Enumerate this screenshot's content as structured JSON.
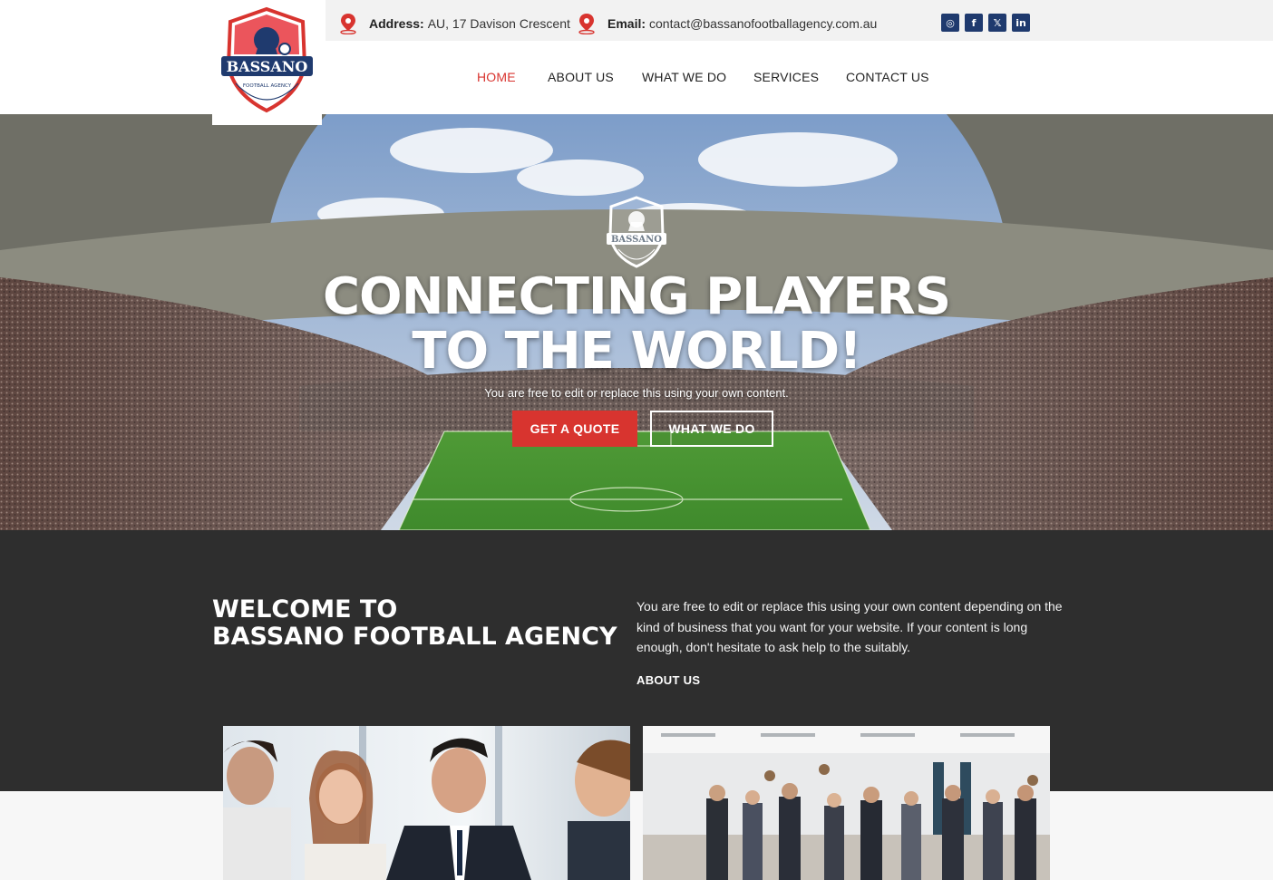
{
  "topbar": {
    "address_label": "Address:",
    "address_value": "AU, 17 Davison Crescent",
    "email_label": "Email:",
    "email_value": "contact@bassanofootballagency.com.au",
    "social": [
      {
        "name": "instagram-icon",
        "glyph": "◎"
      },
      {
        "name": "facebook-icon",
        "glyph": "f"
      },
      {
        "name": "x-icon",
        "glyph": "𝕏"
      },
      {
        "name": "linkedin-icon",
        "glyph": "in"
      }
    ]
  },
  "logo": {
    "brand": "BASSANO",
    "sub": "FOOTBALL AGENCY",
    "motto": "CONNECTING PLAYERS TO THE WORLD"
  },
  "nav": {
    "home": "HOME",
    "about": "ABOUT US",
    "what": "WHAT WE DO",
    "services": "SERVICES",
    "contact": "CONTACT US",
    "active": "home"
  },
  "hero": {
    "title_line1": "CONNECTING PLAYERS",
    "title_line2": "TO THE WORLD!",
    "subtitle": "You are free to edit or replace this using your own content.",
    "btn_quote": "GET A QUOTE",
    "btn_what": "WHAT WE DO"
  },
  "welcome": {
    "title_line1": "WELCOME TO",
    "title_line2": "BASSANO FOOTBALL AGENCY",
    "body": "You are free to edit or replace this using your own content depending on the kind of business that you want for your website. If your content is long enough, don't hesitate to ask help to the suitably.",
    "about_link": "ABOUT US"
  },
  "colors": {
    "accent_red": "#d8342f",
    "brand_navy": "#1f3a6e",
    "dark_section": "#2e2e2e"
  }
}
